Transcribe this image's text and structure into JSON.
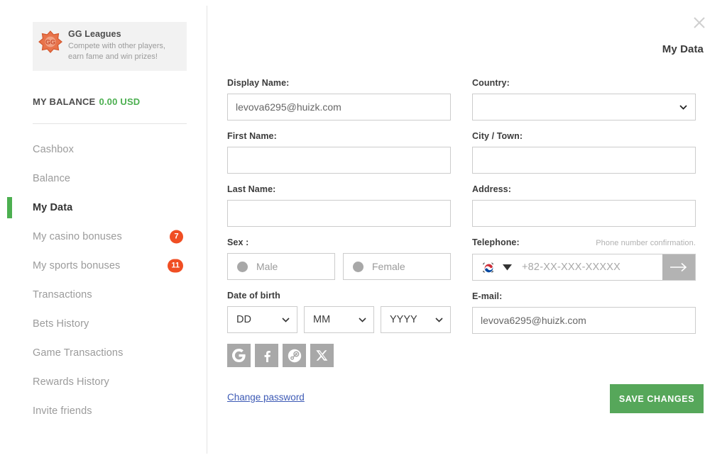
{
  "sidebar": {
    "promo": {
      "icon": "gg-leagues-badge-icon",
      "title": "GG Leagues",
      "subtitle": "Compete with other players, earn fame and win prizes!"
    },
    "balance": {
      "label": "MY BALANCE",
      "value": "0.00 USD",
      "color": "#4caf50"
    },
    "items": [
      {
        "label": "Cashbox",
        "active": false,
        "badge": ""
      },
      {
        "label": "Balance",
        "active": false,
        "badge": ""
      },
      {
        "label": "My Data",
        "active": true,
        "badge": ""
      },
      {
        "label": "My casino bonuses",
        "active": false,
        "badge": "7"
      },
      {
        "label": "My sports bonuses",
        "active": false,
        "badge": "11"
      },
      {
        "label": "Transactions",
        "active": false,
        "badge": ""
      },
      {
        "label": "Bets History",
        "active": false,
        "badge": ""
      },
      {
        "label": "Game Transactions",
        "active": false,
        "badge": ""
      },
      {
        "label": "Rewards History",
        "active": false,
        "badge": ""
      },
      {
        "label": "Invite friends",
        "active": false,
        "badge": ""
      }
    ],
    "badge_color": "#f04e23",
    "active_indicator_color": "#4caf50"
  },
  "main": {
    "close_icon": "close-icon",
    "title": "My Data",
    "left_column": {
      "display_name": {
        "label": "Display Name:",
        "value": "levova6295@huizk.com",
        "placeholder": ""
      },
      "first_name": {
        "label": "First Name:",
        "value": "",
        "placeholder": ""
      },
      "last_name": {
        "label": "Last Name:",
        "value": "",
        "placeholder": ""
      },
      "sex": {
        "label": "Sex :",
        "options": [
          {
            "label": "Male",
            "selected": false
          },
          {
            "label": "Female",
            "selected": false
          }
        ]
      },
      "date_of_birth": {
        "label": "Date of birth",
        "day": "DD",
        "month": "MM",
        "year": "YYYY"
      },
      "socials": [
        {
          "name": "google-icon",
          "label": "G"
        },
        {
          "name": "facebook-icon",
          "label": "f"
        },
        {
          "name": "steam-icon",
          "label": ""
        },
        {
          "name": "x-twitter-icon",
          "label": "X"
        }
      ],
      "change_password_link": "Change password"
    },
    "right_column": {
      "country": {
        "label": "Country:",
        "value": "",
        "placeholder": ""
      },
      "city": {
        "label": "City / Town:",
        "value": "",
        "placeholder": ""
      },
      "address": {
        "label": "Address:",
        "value": "",
        "placeholder": ""
      },
      "telephone": {
        "label": "Telephone:",
        "note": "Phone number confirmation.",
        "flag": "south-korea-flag-icon",
        "placeholder": "+82-XX-XXX-XXXXX",
        "value": "",
        "submit_icon": "arrow-right-icon"
      },
      "email": {
        "label": "E-mail:",
        "value": "levova6295@huizk.com",
        "placeholder": ""
      }
    },
    "save_button": {
      "label": "SAVE CHANGES",
      "color": "#56a75a"
    }
  }
}
